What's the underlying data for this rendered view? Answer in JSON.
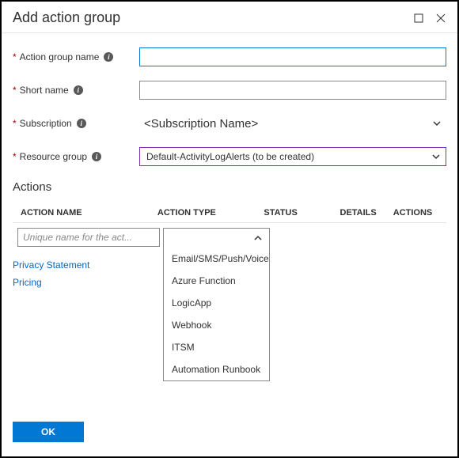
{
  "titlebar": {
    "title": "Add action group"
  },
  "form": {
    "action_group_name": {
      "label": "Action group name",
      "value": ""
    },
    "short_name": {
      "label": "Short name",
      "value": ""
    },
    "subscription": {
      "label": "Subscription",
      "value": "<Subscription Name>"
    },
    "resource_group": {
      "label": "Resource group",
      "value": "Default-ActivityLogAlerts (to be created)"
    }
  },
  "actions": {
    "heading": "Actions",
    "columns": {
      "name": "ACTION NAME",
      "type": "ACTION TYPE",
      "status": "STATUS",
      "details": "DETAILS",
      "actions": "ACTIONS"
    },
    "row": {
      "name_placeholder": "Unique name for the act...",
      "type_options": [
        "Email/SMS/Push/Voice",
        "Azure Function",
        "LogicApp",
        "Webhook",
        "ITSM",
        "Automation Runbook"
      ]
    }
  },
  "links": {
    "privacy": "Privacy Statement",
    "pricing": "Pricing"
  },
  "footer": {
    "ok": "OK"
  }
}
